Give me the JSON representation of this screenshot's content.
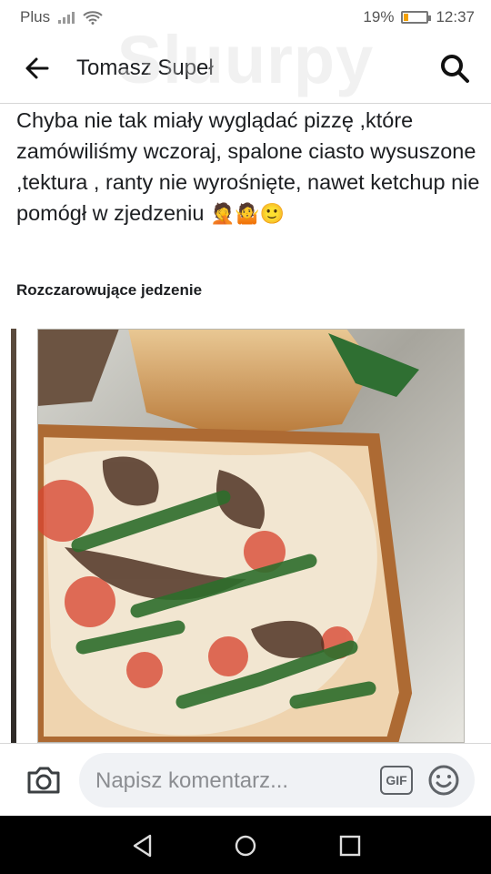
{
  "status_bar": {
    "carrier": "Plus",
    "battery_percent": "19%",
    "battery_level": 0.19,
    "time": "12:37"
  },
  "header": {
    "title": "Tomasz Supeł",
    "back_icon": "arrow-left-icon",
    "search_icon": "search-icon"
  },
  "watermark": "Sluurpy",
  "post": {
    "text": "Chyba nie tak miały wyglądać pizzę ,które zamówiliśmy wczoraj, spalone ciasto wysuszone ,tektura , ranty nie wyrośnięte, nawet ketchup nie pomógł w zjedzeniu",
    "emojis": "🤦🤷🙂",
    "rating_label": "Rozczarowujące jedzenie"
  },
  "composer": {
    "placeholder": "Napisz komentarz...",
    "gif_label": "GIF",
    "camera_icon": "camera-icon",
    "smile_icon": "smile-icon"
  },
  "navigation": {
    "back_icon": "nav-back-icon",
    "home_icon": "nav-home-icon",
    "recents_icon": "nav-recents-icon"
  },
  "colors": {
    "battery": "#f2a000",
    "text": "#1c1e21",
    "placeholder": "#8b8d91",
    "nav_bar": "#000000"
  }
}
